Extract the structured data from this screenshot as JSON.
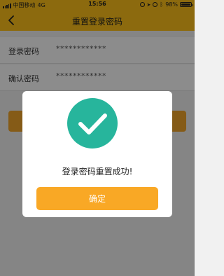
{
  "status_bar": {
    "carrier": "中国移动",
    "network": "4G",
    "time": "15:56",
    "battery_percent": "98%",
    "battery_level": 0.98
  },
  "nav": {
    "title": "重置登录密码",
    "back_icon": "chevron-left-icon"
  },
  "form": {
    "rows": [
      {
        "label": "登录密码",
        "value": "************"
      },
      {
        "label": "确认密码",
        "value": "************"
      }
    ]
  },
  "dialog": {
    "icon": "check-circle-icon",
    "message": "登录密码重置成功!",
    "confirm_label": "确定"
  },
  "colors": {
    "brand_yellow": "#ffc21a",
    "button_orange": "#f9a825",
    "success_teal": "#27b59c"
  }
}
